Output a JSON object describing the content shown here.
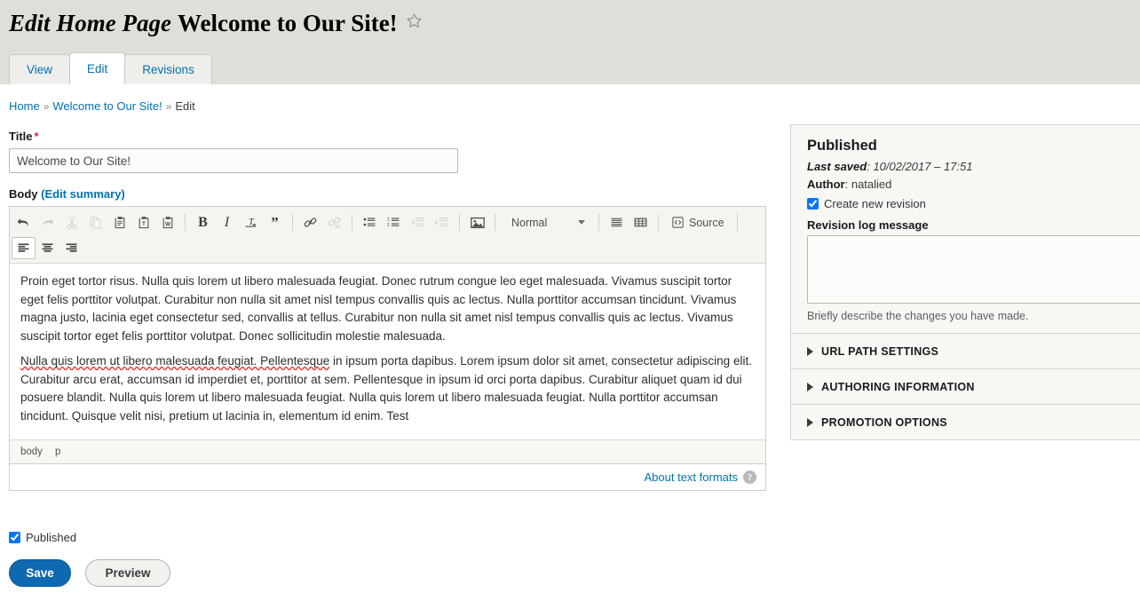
{
  "header": {
    "title_context": "Edit Home Page",
    "title_document": "Welcome to Our Site!",
    "star_icon": "star-outline-icon"
  },
  "tabs": [
    {
      "label": "View",
      "active": false
    },
    {
      "label": "Edit",
      "active": true
    },
    {
      "label": "Revisions",
      "active": false
    }
  ],
  "breadcrumb": {
    "items": [
      "Home",
      "Welcome to Our Site!",
      "Edit"
    ],
    "separator": "»"
  },
  "form": {
    "title_field": {
      "label": "Title",
      "required_marker": "*",
      "value": "Welcome to Our Site!"
    },
    "body_field": {
      "label": "Body",
      "summary_link": "(Edit summary)"
    },
    "published_checkbox": {
      "label": "Published",
      "checked": true
    },
    "save_button": "Save",
    "preview_button": "Preview",
    "about_formats_link": "About text formats",
    "help_icon_glyph": "?"
  },
  "editor": {
    "toolbar_row1": [
      {
        "name": "undo-icon",
        "title": "Undo",
        "disabled": false
      },
      {
        "name": "redo-icon",
        "title": "Redo",
        "disabled": true
      },
      {
        "name": "cut-icon",
        "title": "Cut",
        "disabled": true
      },
      {
        "name": "copy-icon",
        "title": "Copy",
        "disabled": true
      },
      {
        "name": "paste-icon",
        "title": "Paste",
        "disabled": false
      },
      {
        "name": "paste-text-icon",
        "title": "Paste as plain text",
        "disabled": false
      },
      {
        "name": "paste-word-icon",
        "title": "Paste from Word",
        "disabled": false
      },
      {
        "name": "bold-icon",
        "title": "Bold",
        "disabled": false
      },
      {
        "name": "italic-icon",
        "title": "Italic",
        "disabled": false
      },
      {
        "name": "remove-format-icon",
        "title": "Remove Format",
        "disabled": false
      },
      {
        "name": "blockquote-icon",
        "title": "Block Quote",
        "disabled": false
      },
      {
        "name": "link-icon",
        "title": "Link",
        "disabled": false
      },
      {
        "name": "unlink-icon",
        "title": "Unlink",
        "disabled": true
      },
      {
        "name": "bulleted-list-icon",
        "title": "Insert/Remove Bulleted List",
        "disabled": false
      },
      {
        "name": "numbered-list-icon",
        "title": "Insert/Remove Numbered List",
        "disabled": false
      },
      {
        "name": "outdent-icon",
        "title": "Decrease Indent",
        "disabled": true
      },
      {
        "name": "indent-icon",
        "title": "Increase Indent",
        "disabled": true
      },
      {
        "name": "image-icon",
        "title": "Image",
        "disabled": false
      },
      {
        "name": "horizontal-rule-icon",
        "title": "Horizontal Line",
        "disabled": false
      },
      {
        "name": "table-icon",
        "title": "Table",
        "disabled": false
      }
    ],
    "format_select": {
      "value": "Normal"
    },
    "source_button": "Source",
    "toolbar_row2": [
      {
        "name": "align-left-icon",
        "title": "Align Left",
        "active": true
      },
      {
        "name": "align-center-icon",
        "title": "Align Center",
        "active": false
      },
      {
        "name": "align-right-icon",
        "title": "Align Right",
        "active": false
      }
    ],
    "content": {
      "paragraph1": "Proin eget tortor risus. Nulla quis lorem ut libero malesuada feugiat. Donec rutrum congue leo eget malesuada. Vivamus suscipit tortor eget felis porttitor volutpat. Curabitur non nulla sit amet nisl tempus convallis quis ac lectus. Nulla porttitor accumsan tincidunt. Vivamus magna justo, lacinia eget consectetur sed, convallis at tellus. Curabitur non nulla sit amet nisl tempus convallis quis ac lectus. Vivamus suscipit tortor eget felis porttitor volutpat. Donec sollicitudin molestie malesuada.",
      "paragraph2_misspelled": "Nulla quis lorem ut libero malesuada feugiat. Pellentesque",
      "paragraph2_rest": " in ipsum porta dapibus. Lorem ipsum dolor sit amet, consectetur adipiscing elit. Curabitur arcu erat, accumsan id imperdiet et, porttitor at sem. Pellentesque in ipsum id orci porta dapibus. Curabitur aliquet quam id dui posuere blandit. Nulla quis lorem ut libero malesuada feugiat. Nulla quis lorem ut libero malesuada feugiat. Nulla porttitor accumsan tincidunt. Quisque velit nisi, pretium ut lacinia in, elementum id enim. Test"
    },
    "elements_path": [
      "body",
      "p"
    ]
  },
  "sidebar": {
    "status_title": "Published",
    "last_saved_label": "Last saved",
    "last_saved_value": "10/02/2017 – 17:51",
    "author_label": "Author",
    "author_value": "natalied",
    "create_revision_label": "Create new revision",
    "create_revision_checked": true,
    "revision_log_label": "Revision log message",
    "revision_log_value": "",
    "revision_log_description": "Briefly describe the changes you have made.",
    "sections": [
      {
        "label": "URL PATH SETTINGS"
      },
      {
        "label": "AUTHORING INFORMATION"
      },
      {
        "label": "PROMOTION OPTIONS"
      }
    ]
  },
  "colors": {
    "header_bg": "#dfdfd9",
    "link": "#0071b3",
    "primary_button": "#0e69b0",
    "required": "#e02443",
    "spellcheck_underline": "#e03a2f"
  }
}
